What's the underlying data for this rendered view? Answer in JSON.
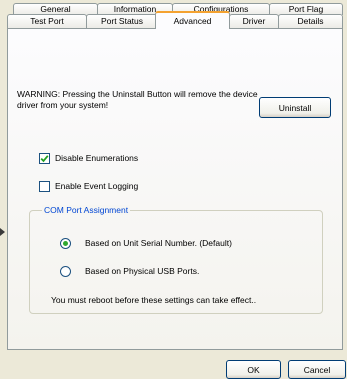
{
  "tabs": {
    "row1": [
      {
        "label": "General"
      },
      {
        "label": "Information"
      },
      {
        "label": "Configurations"
      },
      {
        "label": "Port Flag"
      }
    ],
    "row2": [
      {
        "label": "Test Port"
      },
      {
        "label": "Port Status"
      },
      {
        "label": "Advanced",
        "selected": true
      },
      {
        "label": "Driver"
      },
      {
        "label": "Details"
      }
    ]
  },
  "advanced": {
    "warning_text": "WARNING: Pressing the Uninstall Button will remove the device driver from your system!",
    "uninstall_label": "Uninstall",
    "disable_enumerations": {
      "label": "Disable Enumerations",
      "checked": true
    },
    "enable_event_logging": {
      "label": "Enable Event Logging",
      "checked": false
    },
    "com_port_assignment": {
      "title": "COM Port Assignment",
      "options": [
        {
          "label": "Based on Unit Serial Number. (Default)",
          "selected": true
        },
        {
          "label": "Based on Physical USB Ports.",
          "selected": false
        }
      ],
      "note": "You must reboot before these settings can take effect.."
    }
  },
  "footer": {
    "ok_label": "OK",
    "cancel_label": "Cancel"
  },
  "colors": {
    "dialog_bg": "#ece9d8",
    "selected_tab_accent": "#f4a230",
    "button_border": "#003c74",
    "group_title": "#0046d5",
    "radio_selected": "#2fa82f",
    "check_mark": "#21a121"
  },
  "icons": {
    "checkbox_checked": "check-mark-icon",
    "radio_selected": "radio-dot-icon"
  }
}
